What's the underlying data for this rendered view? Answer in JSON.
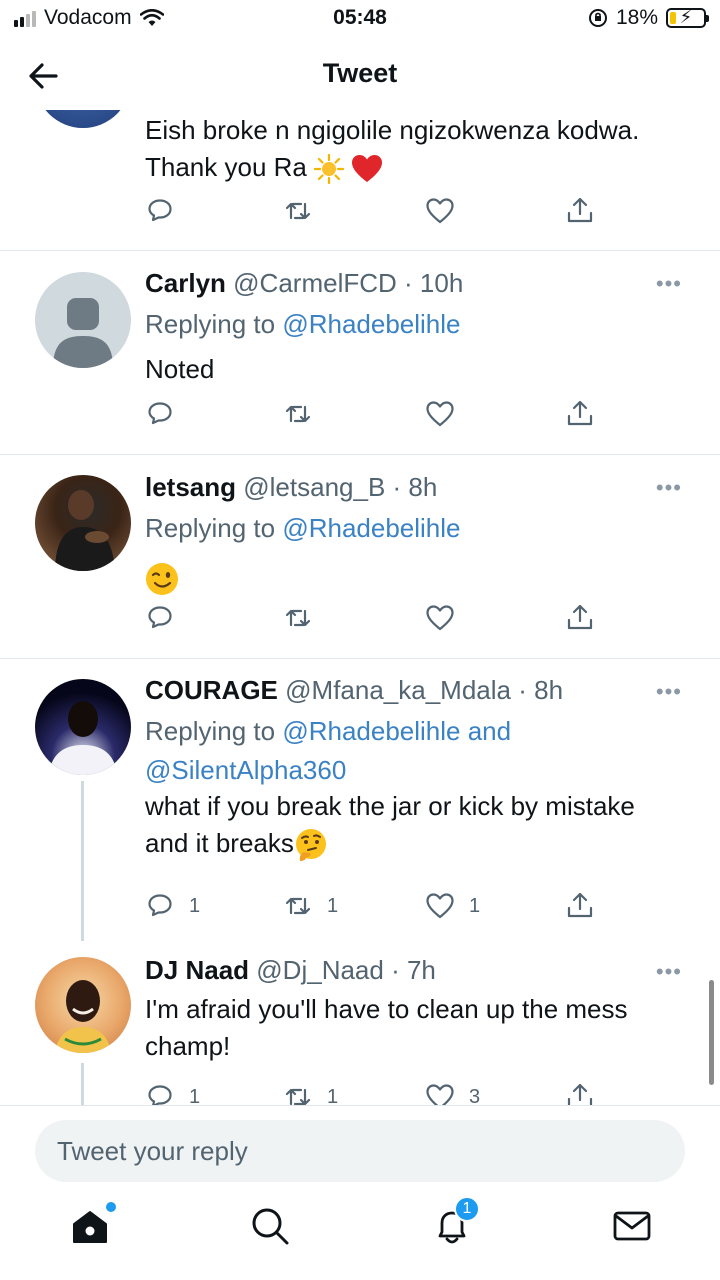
{
  "status_bar": {
    "carrier": "Vodacom",
    "time": "05:48",
    "battery_percent": "18%",
    "battery_level": 0.18
  },
  "header": {
    "title": "Tweet"
  },
  "tweets": [
    {
      "body_line1": "Eish broke n ngigolile ngizokwenza kodwa.",
      "body_line2": "Thank you Ra"
    },
    {
      "name": "Carlyn",
      "handle": "@CarmelFCD",
      "time": "· 10h",
      "replying_prefix": "Replying to",
      "replying_to": "@Rhadebelihle",
      "body": "Noted"
    },
    {
      "name": "letsang",
      "handle": "@letsang_B",
      "time": "· 8h",
      "replying_prefix": "Replying to",
      "replying_to": "@Rhadebelihle",
      "body": ""
    },
    {
      "name": "COURAGE",
      "handle": "@Mfana_ka_Mdala",
      "time": "· 8h",
      "replying_prefix": "Replying to",
      "replying_to": "@Rhadebelihle and",
      "replying_to_2": "@SilentAlpha360",
      "body_line1": "what if you break the jar or kick by mistake",
      "body_line2": "and it breaks",
      "reply_count": "1",
      "retweet_count": "1",
      "like_count": "1"
    },
    {
      "name": "DJ Naad",
      "handle": "@Dj_Naad",
      "time": "· 7h",
      "body_line1": "I'm afraid you'll have to clean up the mess",
      "body_line2": "champ!",
      "reply_count": "1",
      "retweet_count": "1",
      "like_count": "3"
    }
  ],
  "more_label": "•••",
  "reply_box": {
    "placeholder": "Tweet your reply"
  },
  "tab_bar": {
    "notifications_badge": "1"
  },
  "colors": {
    "link": "#3b82c4",
    "accent": "#1d9bf0",
    "divider": "#e1e8ed",
    "muted": "#536471"
  }
}
